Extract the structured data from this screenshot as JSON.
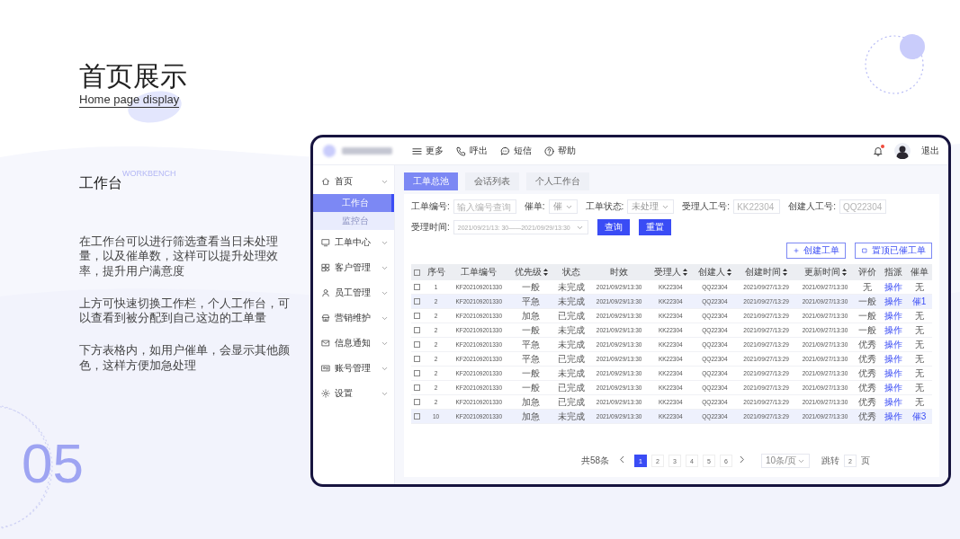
{
  "slide": {
    "title": "首页展示",
    "subtitle": "Home page display",
    "section_title": "工作台",
    "section_tag": "WORKBENCH",
    "paragraphs": [
      "在工作台可以进行筛选查看当日未处理量，以及催单数，这样可以提升处理效率，提升用户满意度",
      "上方可快速切换工作栏，个人工作台，可以查看到被分配到自己这边的工单量",
      "下方表格内，如用户催单，会显示其他颜色，这样方便加急处理"
    ],
    "page_number": "05"
  },
  "app": {
    "header": {
      "menu": [
        "更多",
        "呼出",
        "短信",
        "帮助"
      ],
      "unread": true,
      "logout": "退出"
    },
    "sidebar": {
      "items": [
        {
          "label": "首页",
          "children": [
            {
              "label": "工作台",
              "selected": true
            },
            {
              "label": "监控台",
              "selected": false
            }
          ]
        },
        {
          "label": "工单中心"
        },
        {
          "label": "客户管理"
        },
        {
          "label": "员工管理"
        },
        {
          "label": "营销维护"
        },
        {
          "label": "信息通知"
        },
        {
          "label": "账号管理"
        },
        {
          "label": "设置"
        }
      ]
    },
    "tabs": [
      {
        "label": "工单总池",
        "selected": true
      },
      {
        "label": "会话列表",
        "selected": false
      },
      {
        "label": "个人工作台",
        "selected": false
      }
    ],
    "filters": [
      {
        "kind": "input",
        "label": "工单编号:",
        "placeholder": "输入编号查询"
      },
      {
        "kind": "select",
        "label": "催单:",
        "value": "催"
      },
      {
        "kind": "select",
        "label": "工单状态:",
        "value": "未处理"
      },
      {
        "kind": "input",
        "label": "受理人工号:",
        "placeholder": "KK22304"
      },
      {
        "kind": "input",
        "label": "创建人工号:",
        "placeholder": "QQ22304"
      }
    ],
    "date_filter": {
      "label": "受理时间:",
      "value": "2021/09/21/13: 30——2021/09/29/13:30"
    },
    "buttons": [
      "查询",
      "重置"
    ],
    "actions": [
      "创建工单",
      "置顶已催工单"
    ],
    "table": {
      "header_checked": false,
      "columns": [
        {
          "kind": "text",
          "label": "序号",
          "sortable": false
        },
        {
          "kind": "text",
          "label": "工单编号",
          "sortable": false
        },
        {
          "kind": "text",
          "label": "优先级",
          "sortable": true
        },
        {
          "kind": "text",
          "label": "状态",
          "sortable": false
        },
        {
          "kind": "text",
          "label": "时效",
          "sortable": false
        },
        {
          "kind": "text",
          "label": "受理人",
          "sortable": true
        },
        {
          "kind": "text",
          "label": "创建人",
          "sortable": true
        },
        {
          "kind": "text",
          "label": "创建时间",
          "sortable": true
        },
        {
          "kind": "text",
          "label": "更新时间",
          "sortable": true
        },
        {
          "kind": "text",
          "label": "评价",
          "sortable": false
        },
        {
          "kind": "link",
          "label": "指派",
          "sortable": false
        },
        {
          "kind": "urge",
          "label": "催单",
          "sortable": false
        }
      ],
      "rows": [
        {
          "checked": false,
          "urged": false,
          "cells": [
            "1",
            "KF202109201330",
            "一般",
            "未完成",
            "2021/09/29/13:30",
            "KK22304",
            "QQ22304",
            "2021/09/27/13:29",
            "2021/09/27/13:30",
            "无",
            "操作",
            "无"
          ]
        },
        {
          "checked": false,
          "urged": true,
          "cells": [
            "2",
            "KF202109201330",
            "平急",
            "未完成",
            "2021/09/29/13:30",
            "KK22304",
            "QQ22304",
            "2021/09/27/13:29",
            "2021/09/27/13:30",
            "一般",
            "操作",
            "催1"
          ]
        },
        {
          "checked": false,
          "urged": false,
          "cells": [
            "2",
            "KF202109201330",
            "加急",
            "已完成",
            "2021/09/29/13:30",
            "KK22304",
            "QQ22304",
            "2021/09/27/13:29",
            "2021/09/27/13:30",
            "一般",
            "操作",
            "无"
          ]
        },
        {
          "checked": false,
          "urged": false,
          "cells": [
            "2",
            "KF202109201330",
            "一般",
            "未完成",
            "2021/09/29/13:30",
            "KK22304",
            "QQ22304",
            "2021/09/27/13:29",
            "2021/09/27/13:30",
            "一般",
            "操作",
            "无"
          ]
        },
        {
          "checked": false,
          "urged": false,
          "cells": [
            "2",
            "KF202109201330",
            "平急",
            "未完成",
            "2021/09/29/13:30",
            "KK22304",
            "QQ22304",
            "2021/09/27/13:29",
            "2021/09/27/13:30",
            "优秀",
            "操作",
            "无"
          ]
        },
        {
          "checked": false,
          "urged": false,
          "cells": [
            "2",
            "KF202109201330",
            "平急",
            "已完成",
            "2021/09/29/13:30",
            "KK22304",
            "QQ22304",
            "2021/09/27/13:29",
            "2021/09/27/13:30",
            "优秀",
            "操作",
            "无"
          ]
        },
        {
          "checked": false,
          "urged": false,
          "cells": [
            "2",
            "KF202109201330",
            "一般",
            "未完成",
            "2021/09/29/13:30",
            "KK22304",
            "QQ22304",
            "2021/09/27/13:29",
            "2021/09/27/13:30",
            "优秀",
            "操作",
            "无"
          ]
        },
        {
          "checked": false,
          "urged": false,
          "cells": [
            "2",
            "KF202109201330",
            "一般",
            "已完成",
            "2021/09/29/13:30",
            "KK22304",
            "QQ22304",
            "2021/09/27/13:29",
            "2021/09/27/13:30",
            "优秀",
            "操作",
            "无"
          ]
        },
        {
          "checked": false,
          "urged": false,
          "cells": [
            "2",
            "KF202109201330",
            "加急",
            "已完成",
            "2021/09/29/13:30",
            "KK22304",
            "QQ22304",
            "2021/09/27/13:29",
            "2021/09/27/13:30",
            "优秀",
            "操作",
            "无"
          ]
        },
        {
          "checked": false,
          "urged": true,
          "cells": [
            "10",
            "KF202109201330",
            "加急",
            "未完成",
            "2021/09/29/13:30",
            "KK22304",
            "QQ22304",
            "2021/09/27/13:29",
            "2021/09/27/13:30",
            "优秀",
            "操作",
            "催3"
          ]
        }
      ]
    },
    "pagination": {
      "total": "共58条",
      "pages": [
        {
          "label": "1",
          "selected": true
        },
        {
          "label": "2",
          "selected": false
        },
        {
          "label": "3",
          "selected": false
        },
        {
          "label": "4",
          "selected": false
        },
        {
          "label": "5",
          "selected": false
        },
        {
          "label": "6",
          "selected": false
        }
      ],
      "page_size": "10条/页",
      "jump_label": "跳转",
      "jump_value": "2",
      "jump_suffix": "页"
    }
  }
}
